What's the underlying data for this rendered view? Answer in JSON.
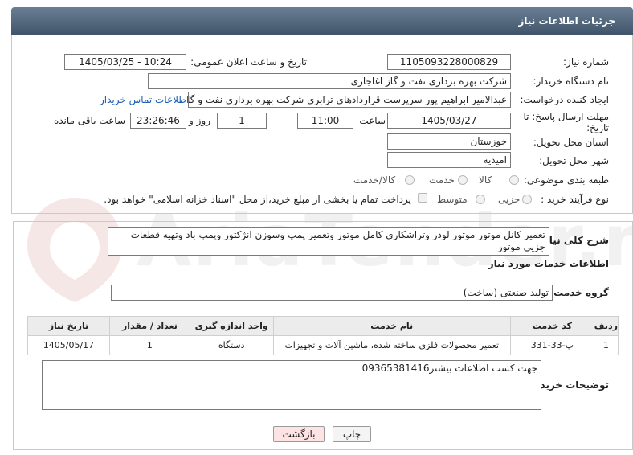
{
  "header": {
    "title": "جزئیات اطلاعات نیاز"
  },
  "watermark": {
    "text": "AriaTender.net"
  },
  "form": {
    "need_number_label": "شماره نیاز:",
    "need_number": "1105093228000829",
    "announce_label": "تاریخ و ساعت اعلان عمومی:",
    "announce_value": "1405/03/25 - 10:24",
    "buyer_org_label": "نام دستگاه خریدار:",
    "buyer_org": "شرکت بهره برداری نفت و گاز اغاجاری",
    "creator_label": "ایجاد کننده درخواست:",
    "creator": "عبدالامیر ابراهیم پور سرپرست قراردادهای ترابری شرکت بهره برداری نفت و گاز",
    "contact_link": "اطلاعات تماس خریدار",
    "deadline_label_1": "مهلت ارسال پاسخ: تا",
    "deadline_label_2": "تاریخ:",
    "deadline_date": "1405/03/27",
    "time_label": "ساعت",
    "deadline_time": "11:00",
    "days_value": "1",
    "days_label": "روز و",
    "remaining_time": "23:26:46",
    "remaining_label": "ساعت باقی مانده",
    "province_label": "استان محل تحویل:",
    "province": "خوزستان",
    "city_label": "شهر محل تحویل:",
    "city": "امیدیه",
    "category_label": "طبقه بندی موضوعی:",
    "category_options": [
      "کالا",
      "خدمت",
      "کالا/خدمت"
    ],
    "process_label": "نوع فرآیند خرید :",
    "process_options": [
      "جزیی",
      "متوسط"
    ],
    "payment_note": "پرداخت تمام یا بخشی از مبلغ خرید،از محل \"اسناد خزانه اسلامی\" خواهد بود."
  },
  "details": {
    "summary_label": "شرح کلی نیاز:",
    "summary": "تعمیر کانل موتور موتور لودر وتراشکاری کامل موتور وتعمیر پمپ وسوزن انژکتور وپمپ باد وتهیه قطعات جزیی موتور",
    "services_heading": "اطلاعات خدمات مورد نیاز",
    "service_group_label": "گروه خدمت:",
    "service_group": "تولید صنعتی (ساخت)",
    "table": {
      "headers": [
        "ردیف",
        "کد خدمت",
        "نام خدمت",
        "واحد اندازه گیری",
        "تعداد / مقدار",
        "تاریخ نیاز"
      ],
      "rows": [
        [
          "1",
          "پ-33-331",
          "تعمیر محصولات فلزی ساخته شده، ماشین آلات و تجهیزات",
          "دستگاه",
          "1",
          "1405/05/17"
        ]
      ]
    },
    "buyer_notes_label": "توضیحات خریدار:",
    "buyer_notes": "جهت کسب اطلاعات بیشتر09365381416"
  },
  "buttons": {
    "print": "چاپ",
    "back": "بازگشت"
  },
  "colors": {
    "header_bg": "#4f6478",
    "link": "#1a5fb4",
    "back_button_bg": "#fde3e3"
  }
}
